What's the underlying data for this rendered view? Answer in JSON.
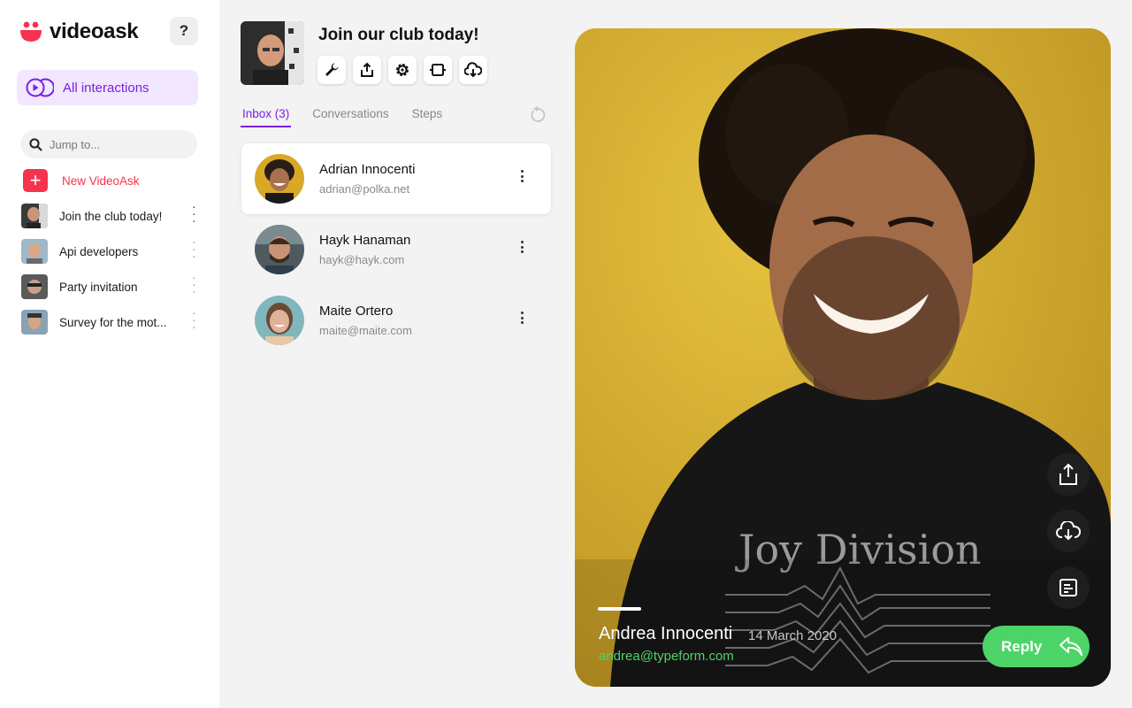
{
  "app": {
    "name": "videoask"
  },
  "sidebar": {
    "help_label": "?",
    "all_interactions_label": "All interactions",
    "search_placeholder": "Jump to...",
    "new_label": "New VideoAsk",
    "new_icon": "+",
    "items": [
      {
        "label": "Join the club today!"
      },
      {
        "label": "Api developers"
      },
      {
        "label": "Party invitation"
      },
      {
        "label": "Survey for the mot..."
      }
    ]
  },
  "header": {
    "title": "Join our club today!",
    "tools": [
      "wrench-icon",
      "share-icon",
      "gear-icon",
      "embed-icon",
      "cloud-download-icon"
    ]
  },
  "tabs": [
    {
      "label": "Inbox (3)"
    },
    {
      "label": "Conversations"
    },
    {
      "label": "Steps"
    }
  ],
  "inbox": [
    {
      "name": "Adrian Innocenti",
      "email": "adrian@polka.net",
      "selected": true
    },
    {
      "name": "Hayk Hanaman",
      "email": "hayk@hayk.com",
      "selected": false
    },
    {
      "name": "Maite Ortero",
      "email": "maite@maite.com",
      "selected": false
    }
  ],
  "video": {
    "name": "Andrea Innocenti",
    "date": "14 March 2020",
    "email": "andrea@typeform.com",
    "reply_label": "Reply",
    "shirt_text": "Joy Division",
    "actions": [
      "share-icon",
      "cloud-download-icon",
      "transcript-icon"
    ]
  },
  "colors": {
    "accent": "#7b1fe0",
    "brand_red": "#f5334f",
    "reply_green": "#4cd468",
    "video_bg": "#d8b23a"
  }
}
